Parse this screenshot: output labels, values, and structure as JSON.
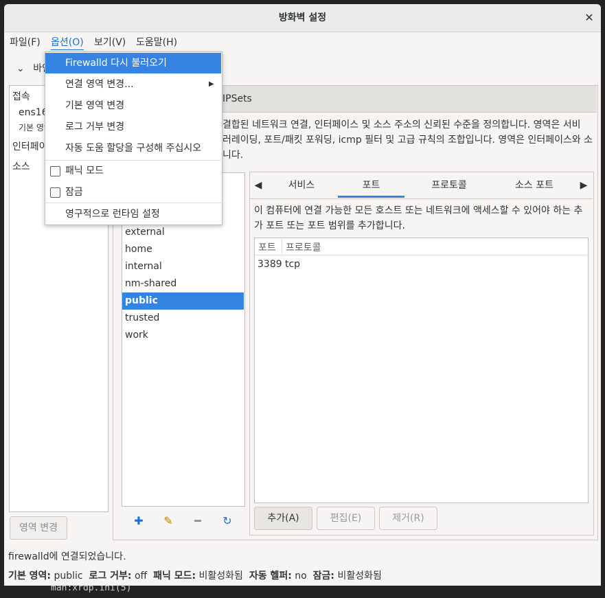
{
  "window": {
    "title": "방화벽 설정",
    "close_icon": "✕"
  },
  "menubar": {
    "file": "파일(F)",
    "options": "옵션(O)",
    "view": "보기(V)",
    "help": "도움말(H)"
  },
  "binding": {
    "label": "바인"
  },
  "left_panel": {
    "section_connections": "접속",
    "connection_name": "ens16",
    "connection_zone": "기본 영역",
    "section_interfaces": "인터페이",
    "section_sources": "소스",
    "zone_change_button": "영역 변경"
  },
  "top_tabs": {
    "ipsets": "IPSets"
  },
  "zone_description": [
    "결합된 네트워크 연결, 인터페이스 및 소스 주소의 신뢰된 수준을 정의합니다. 영역은 서비",
    "러레이딩, 포트/패킷 포워딩, icmp 필터 및 고급 규칙의 조합입니다. 영역은 인터페이스와 소",
    "니다."
  ],
  "zones": [
    {
      "name": "external",
      "selected": false
    },
    {
      "name": "home",
      "selected": false
    },
    {
      "name": "internal",
      "selected": false
    },
    {
      "name": "nm-shared",
      "selected": false
    },
    {
      "name": "public",
      "selected": true
    },
    {
      "name": "trusted",
      "selected": false
    },
    {
      "name": "work",
      "selected": false
    }
  ],
  "zone_tools": {
    "add_icon": "plus-icon",
    "edit_icon": "edit-icon",
    "remove_icon": "minus-icon",
    "load_icon": "reload-icon"
  },
  "notebook": {
    "tabs": [
      "서비스",
      "포트",
      "프로토콜",
      "소스 포트"
    ],
    "active_tab": "포트",
    "ports_description_1": "이 컴퓨터에 연결 가능한 모든 호스트 또는 네트워크에 액세스할 수 있어야 하는 추",
    "ports_description_2": "가 포트 또는 포트 범위를 추가합니다.",
    "columns": [
      "포트",
      "프로토콜"
    ],
    "rows": [
      {
        "port": "3389",
        "protocol": "tcp"
      }
    ],
    "add_button": "추가(A)",
    "edit_button": "편집(E)",
    "remove_button": "제거(R)"
  },
  "status": {
    "connection": "firewalld에 연결되었습니다.",
    "default_zone_label": "기본 영역:",
    "default_zone_value": "public",
    "log_denied_label": "로그 거부:",
    "log_denied_value": "off",
    "panic_label": "패닉 모드:",
    "panic_value": "비활성화됨",
    "auto_helper_label": "자동 헬퍼:",
    "auto_helper_value": "no",
    "lock_label": "잠금:",
    "lock_value": "비활성화됨"
  },
  "options_menu": {
    "reload": "Firewalld 다시 불러오기",
    "change_connection_zone": "연결 영역 변경...",
    "change_default_zone": "기본 영역 변경",
    "change_log_denied": "로그 거부 변경",
    "configure_auto_helper": "자동 도움 할당을 구성해 주십시오",
    "panic_mode": "패닉 모드",
    "panic_mode_checked": false,
    "lockdown": "잠금",
    "lockdown_checked": false,
    "runtime_to_permanent": "영구적으로 런타임 설정"
  },
  "terminal": {
    "bottom_text": "man:xrdp.ini(5)"
  }
}
